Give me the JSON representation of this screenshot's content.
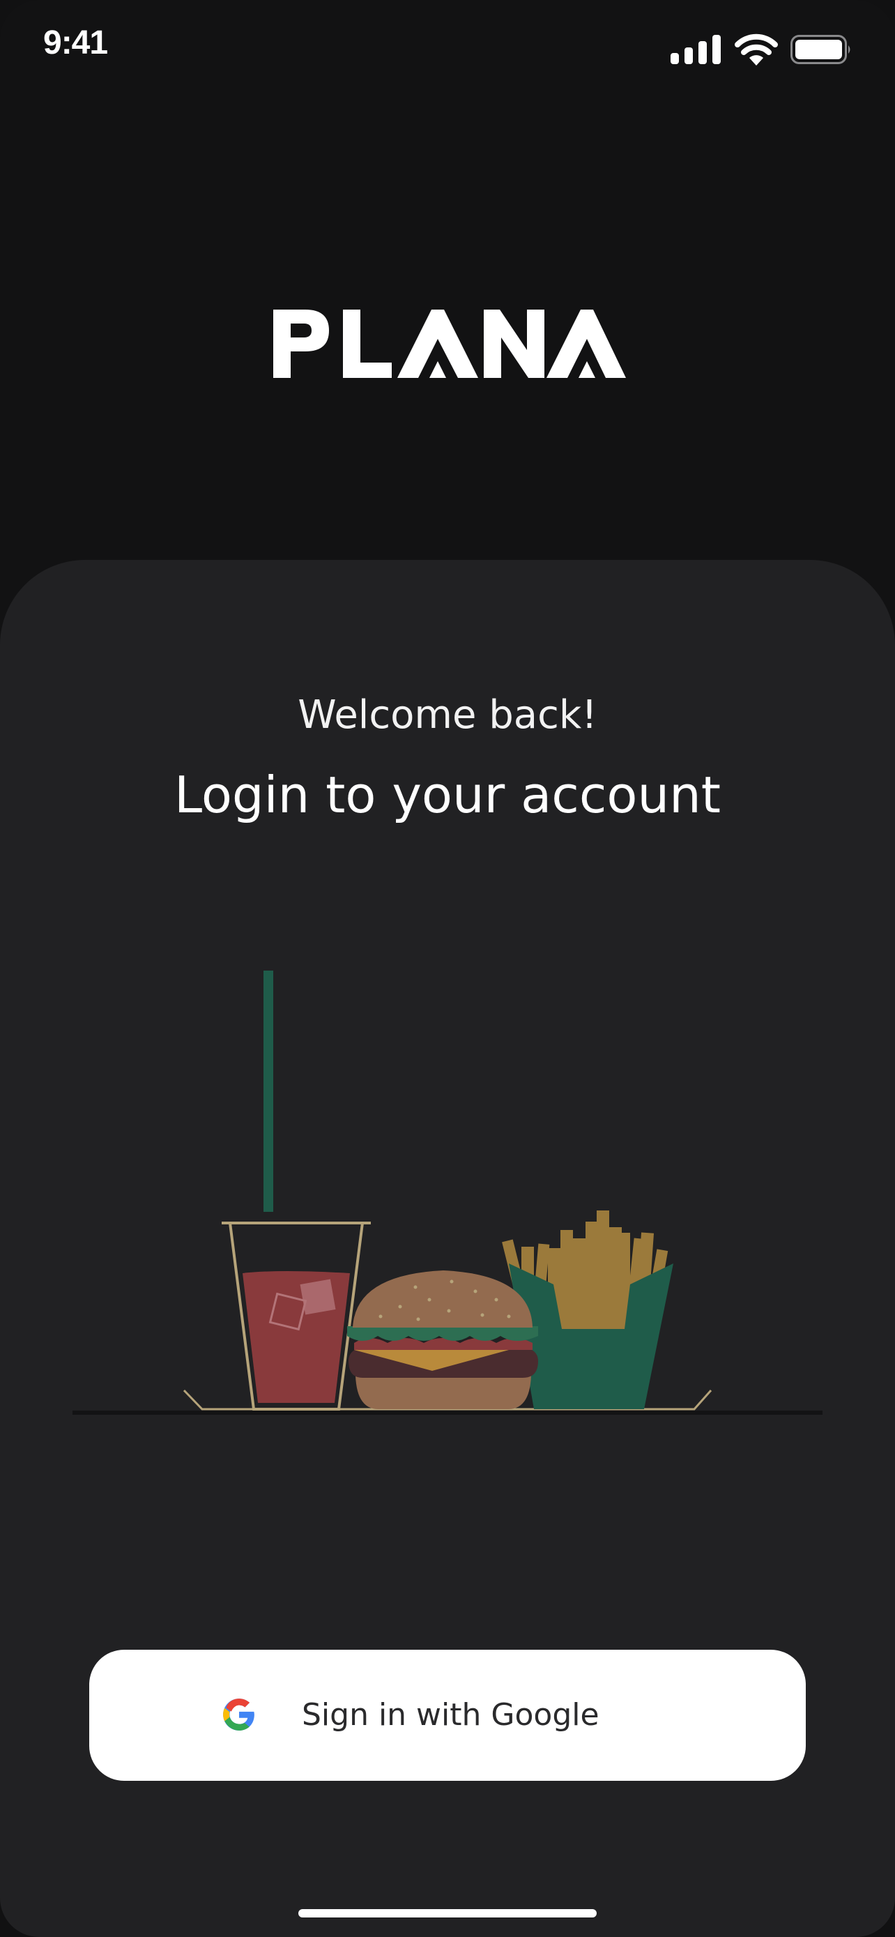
{
  "status_bar": {
    "time": "9:41",
    "icons": [
      "signal-icon",
      "wifi-icon",
      "battery-icon"
    ]
  },
  "brand": {
    "logo_text": "PLANA",
    "logo_color": "#ffffff"
  },
  "login": {
    "welcome": "Welcome back!",
    "headline": "Login to your account"
  },
  "illustration": {
    "items": [
      "drink-cup",
      "straw",
      "burger",
      "fries"
    ],
    "colors": {
      "straw": "#1f5c4a",
      "drink": "#893a3c",
      "bun": "#936b4f",
      "lettuce": "#2d6e52",
      "patty": "#4a2c2f",
      "cheese": "#b98a3b",
      "fries": "#9b7a3b",
      "fries_box": "#1f5c4a",
      "outline": "#b6a47a",
      "table": "#131314"
    }
  },
  "google_signin": {
    "label": "Sign in with Google",
    "icon": "google-icon",
    "background": "#ffffff"
  },
  "theme": {
    "background": "#121213",
    "sheet": "#212123"
  }
}
